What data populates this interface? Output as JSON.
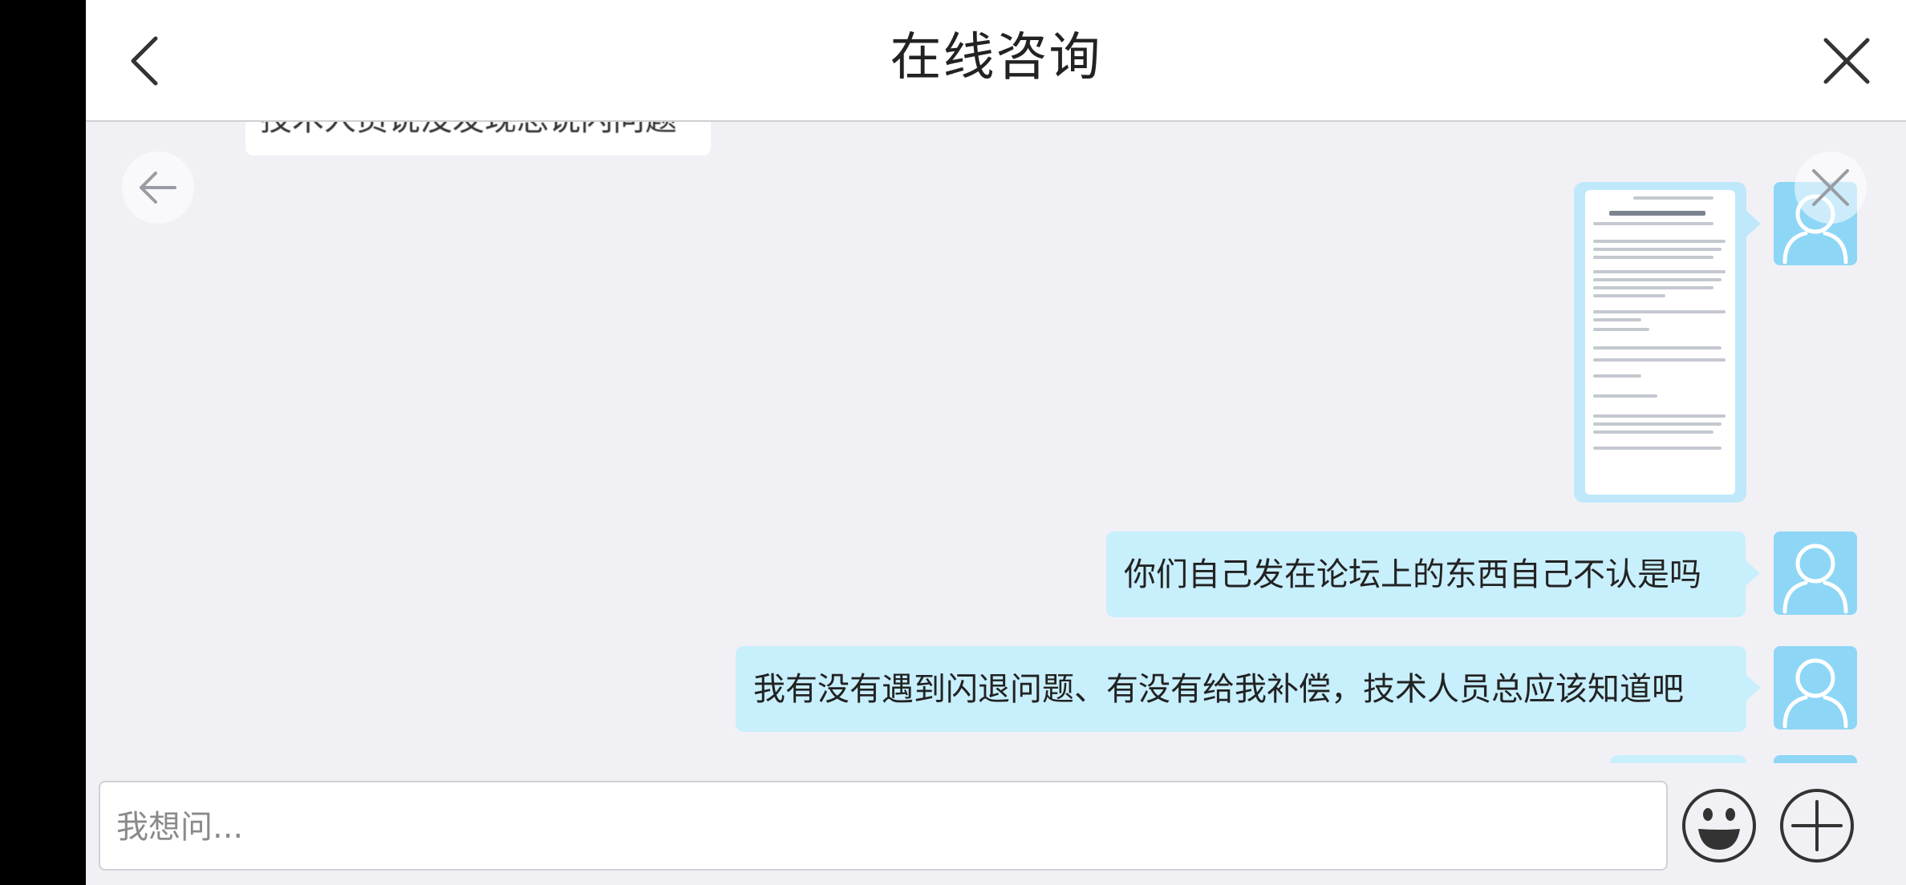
{
  "header": {
    "title": "在线咨询"
  },
  "chat": {
    "partial_message": "技术人员说没发现总说闪问题",
    "messages": [
      {
        "type": "image",
        "sender": "self"
      },
      {
        "type": "text",
        "sender": "self",
        "text": "你们自己发在论坛上的东西自己不认是吗"
      },
      {
        "type": "text",
        "sender": "self",
        "text": "我有没有遇到闪退问题、有没有给我补偿，技术人员总应该知道吧"
      }
    ]
  },
  "input": {
    "placeholder": "我想问..."
  },
  "icons": {
    "back": "chevron-left-icon",
    "close": "close-icon",
    "avatar": "user-avatar-icon",
    "emoji": "smiley-icon",
    "add": "plus-circle-icon"
  },
  "colors": {
    "bubble_self": "#c8effc",
    "avatar_bg": "#8ed6f5",
    "chat_bg": "#f1f1f5"
  }
}
